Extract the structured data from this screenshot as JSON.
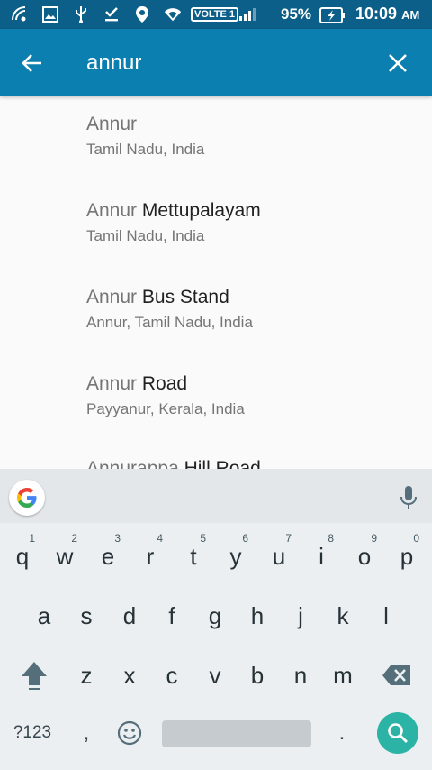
{
  "status_bar": {
    "volte": "VOLTE 1",
    "battery": "95%",
    "time": "10:09",
    "ampm": "AM"
  },
  "search": {
    "query": "annur"
  },
  "results": [
    {
      "match": "Annur",
      "rest": "",
      "sub": "Tamil Nadu, India"
    },
    {
      "match": "Annur",
      "rest": " Mettupalayam",
      "sub": "Tamil Nadu, India"
    },
    {
      "match": "Annur",
      "rest": " Bus Stand",
      "sub": "Annur, Tamil Nadu, India"
    },
    {
      "match": "Annur",
      "rest": " Road",
      "sub": "Payyanur, Kerala, India"
    },
    {
      "match": "Annurappa",
      "rest": " Hill Road",
      "sub": ""
    }
  ],
  "keyboard": {
    "row1": [
      "q",
      "w",
      "e",
      "r",
      "t",
      "y",
      "u",
      "i",
      "o",
      "p"
    ],
    "hints": [
      "1",
      "2",
      "3",
      "4",
      "5",
      "6",
      "7",
      "8",
      "9",
      "0"
    ],
    "row2": [
      "a",
      "s",
      "d",
      "f",
      "g",
      "h",
      "j",
      "k",
      "l"
    ],
    "row3": [
      "z",
      "x",
      "c",
      "v",
      "b",
      "n",
      "m"
    ],
    "symbols": "?123",
    "comma": ",",
    "period": "."
  },
  "colors": {
    "status_bar": "#0b5f88",
    "app_bar": "#0b80b0",
    "enter_key": "#2bb3a6"
  }
}
